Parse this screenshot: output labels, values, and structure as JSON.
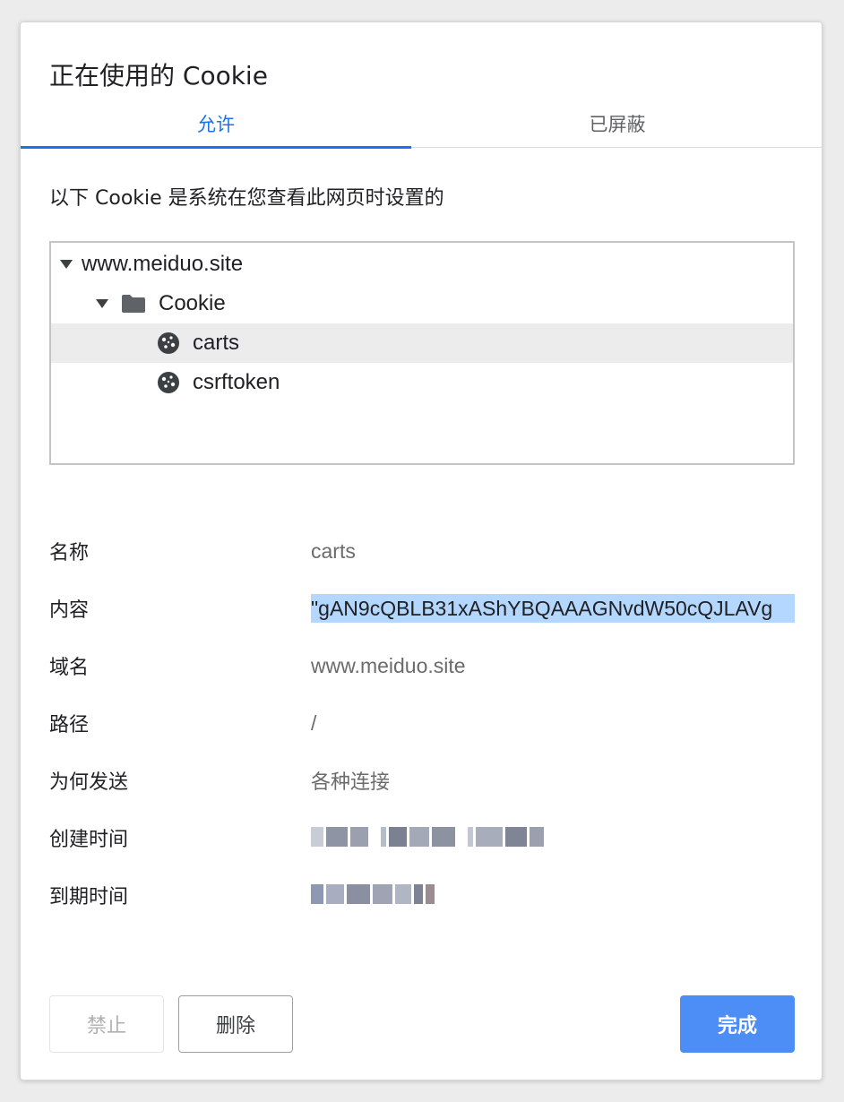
{
  "dialog": {
    "title": "正在使用的 Cookie",
    "tabs": [
      {
        "label": "允许",
        "active": true
      },
      {
        "label": "已屏蔽",
        "active": false
      }
    ],
    "description": "以下 Cookie 是系统在您查看此网页时设置的"
  },
  "tree": {
    "site": "www.meiduo.site",
    "folder": "Cookie",
    "cookies": [
      {
        "name": "carts",
        "selected": true
      },
      {
        "name": "csrftoken",
        "selected": false
      }
    ]
  },
  "details": {
    "name_label": "名称",
    "name_value": "carts",
    "content_label": "内容",
    "content_value": "\"gAN9cQBLB31xAShYBQAAAGNvdW50cQJLAVg",
    "domain_label": "域名",
    "domain_value": "www.meiduo.site",
    "path_label": "路径",
    "path_value": "/",
    "send_for_label": "为何发送",
    "send_for_value": "各种连接",
    "created_label": "创建时间",
    "expires_label": "到期时间"
  },
  "buttons": {
    "block": "禁止",
    "remove": "删除",
    "done": "完成"
  },
  "colors": {
    "accent": "#1a73e8",
    "primary_button": "#4c8ef5",
    "selection": "#b3d7ff"
  }
}
